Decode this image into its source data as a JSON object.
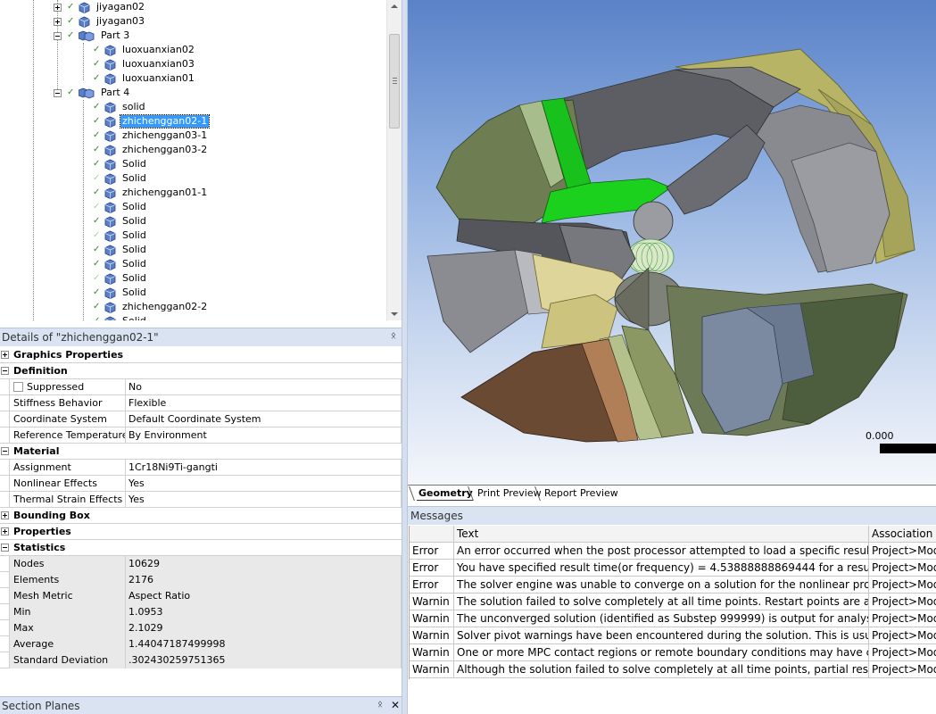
{
  "tree": {
    "items": [
      {
        "label": "jiyagan02",
        "kind": "body",
        "check": "dark"
      },
      {
        "label": "jiyagan03",
        "kind": "body",
        "check": "dark"
      },
      {
        "label": "Part 3",
        "kind": "part"
      },
      {
        "label": "luoxuanxian02",
        "kind": "body",
        "check": "dark"
      },
      {
        "label": "luoxuanxian03",
        "kind": "body",
        "check": "dark"
      },
      {
        "label": "luoxuanxian01",
        "kind": "body",
        "check": "dark"
      },
      {
        "label": "Part 4",
        "kind": "part"
      },
      {
        "label": "solid",
        "kind": "body",
        "check": "dark"
      },
      {
        "label": "zhichenggan02-1",
        "kind": "body",
        "check": "dark",
        "selected": true
      },
      {
        "label": "zhichenggan03-1",
        "kind": "body",
        "check": "dark"
      },
      {
        "label": "zhichenggan03-2",
        "kind": "body",
        "check": "dark"
      },
      {
        "label": "Solid",
        "kind": "body",
        "check": "dark"
      },
      {
        "label": "Solid",
        "kind": "body",
        "check": "light"
      },
      {
        "label": "zhichenggan01-1",
        "kind": "body",
        "check": "dark"
      },
      {
        "label": "Solid",
        "kind": "body",
        "check": "light"
      },
      {
        "label": "Solid",
        "kind": "body",
        "check": "dark"
      },
      {
        "label": "Solid",
        "kind": "body",
        "check": "light"
      },
      {
        "label": "Solid",
        "kind": "body",
        "check": "dark"
      },
      {
        "label": "Solid",
        "kind": "body",
        "check": "dark"
      },
      {
        "label": "Solid",
        "kind": "body",
        "check": "light"
      },
      {
        "label": "Solid",
        "kind": "body",
        "check": "dark"
      },
      {
        "label": "zhichenggan02-2",
        "kind": "body",
        "check": "dark"
      },
      {
        "label": "Solid",
        "kind": "body",
        "check": "dark"
      }
    ]
  },
  "details": {
    "title": "Details of \"zhichenggan02-1\"",
    "rows": [
      {
        "type": "group",
        "label": "Graphics Properties",
        "collapsed": true
      },
      {
        "type": "group",
        "label": "Definition",
        "collapsed": false
      },
      {
        "type": "prop",
        "label": "Suppressed",
        "value": "No",
        "checkbox": true
      },
      {
        "type": "prop",
        "label": "Stiffness Behavior",
        "value": "Flexible"
      },
      {
        "type": "prop",
        "label": "Coordinate System",
        "value": "Default Coordinate System"
      },
      {
        "type": "prop",
        "label": "Reference Temperature",
        "value": "By Environment"
      },
      {
        "type": "group",
        "label": "Material",
        "collapsed": false
      },
      {
        "type": "prop",
        "label": "Assignment",
        "value": "1Cr18Ni9Ti-gangti"
      },
      {
        "type": "prop",
        "label": "Nonlinear Effects",
        "value": "Yes"
      },
      {
        "type": "prop",
        "label": "Thermal Strain Effects",
        "value": "Yes"
      },
      {
        "type": "group",
        "label": "Bounding Box",
        "collapsed": true
      },
      {
        "type": "group",
        "label": "Properties",
        "collapsed": true
      },
      {
        "type": "group",
        "label": "Statistics",
        "collapsed": false
      },
      {
        "type": "prop",
        "label": "Nodes",
        "value": "10629",
        "grey": true
      },
      {
        "type": "prop",
        "label": "Elements",
        "value": "2176",
        "grey": true
      },
      {
        "type": "prop",
        "label": "Mesh Metric",
        "value": "Aspect Ratio",
        "grey": true
      },
      {
        "type": "prop",
        "label": "Min",
        "value": "1.0953",
        "grey": true
      },
      {
        "type": "prop",
        "label": "Max",
        "value": "2.1029",
        "grey": true
      },
      {
        "type": "prop",
        "label": "Average",
        "value": "1.44047187499998",
        "grey": true
      },
      {
        "type": "prop",
        "label": "Standard Deviation",
        "value": ".302430259751365",
        "grey": true
      }
    ]
  },
  "section_planes": {
    "title": "Section Planes",
    "close": "✕"
  },
  "pin_glyph": "ᛟ",
  "viewport": {
    "scale_label": "0.000"
  },
  "view_tabs": [
    "Geometry",
    "Print Preview",
    "Report Preview"
  ],
  "messages": {
    "title": "Messages",
    "headers": {
      "type": "",
      "text": "Text",
      "association": "Association"
    },
    "rows": [
      {
        "type": "Error",
        "text": "An error occurred when the post processor attempted to load a specific result",
        "assoc": "Project>Model"
      },
      {
        "type": "Error",
        "text": "You have specified result time(or frequency) = 4.53888888869444 for a result f",
        "assoc": "Project>Model"
      },
      {
        "type": "Error",
        "text": "The solver engine was unable to converge on a solution for the nonlinear prob",
        "assoc": "Project>Model"
      },
      {
        "type": "Warnin",
        "text": "The solution failed to solve completely at all time points. Restart points are ava",
        "assoc": "Project>Model"
      },
      {
        "type": "Warnin",
        "text": "The unconverged solution (identified as Substep 999999) is output for analysis",
        "assoc": "Project>Model"
      },
      {
        "type": "Warnin",
        "text": "Solver pivot warnings have been encountered during the solution.  This is usua",
        "assoc": "Project>Model"
      },
      {
        "type": "Warnin",
        "text": "One or more MPC contact regions or remote boundary conditions may have c",
        "assoc": "Project>Model"
      },
      {
        "type": "Warnin",
        "text": "Although the solution failed to solve completely at all time points, partial result",
        "assoc": "Project>Model"
      }
    ]
  }
}
